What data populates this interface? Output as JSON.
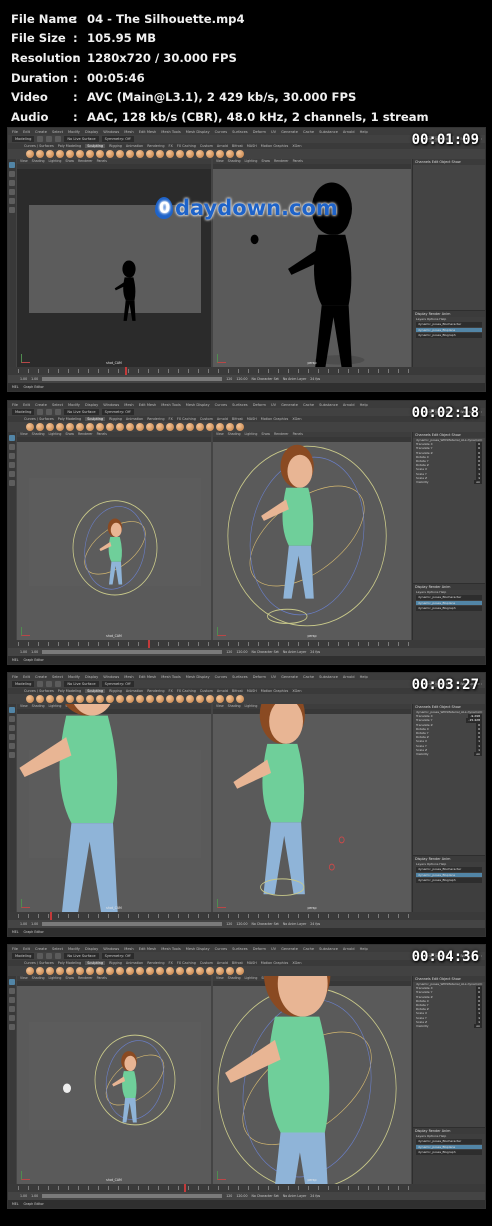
{
  "file_info": [
    {
      "key": "File Name",
      "value": "04 - The Silhouette.mp4"
    },
    {
      "key": "File Size",
      "value": "105.95 MB"
    },
    {
      "key": "Resolution",
      "value": "1280x720 / 30.000 FPS"
    },
    {
      "key": "Duration",
      "value": "00:05:46"
    },
    {
      "key": "Video",
      "value": "AVC (Main@L3.1), 2 429 kb/s, 30.000 FPS"
    },
    {
      "key": "Audio",
      "value": "AAC, 128 kb/s (CBR), 48.0 kHz, 2 channels, 1 stream"
    }
  ],
  "colon": ":",
  "app": {
    "menus": [
      "File",
      "Edit",
      "Create",
      "Select",
      "Modify",
      "Display",
      "Windows",
      "Mesh",
      "Edit Mesh",
      "Mesh Tools",
      "Mesh Display",
      "Curves",
      "Surfaces",
      "Deform",
      "UV",
      "Generate",
      "Cache",
      "Substance",
      "Arnold",
      "Help"
    ],
    "workspace": "Workspace :",
    "mode": "Modeling",
    "no_live_surface": "No Live Surface",
    "symmetry": "Symmetry: Off",
    "sign_in": "Show Optimizer",
    "shelf_tabs": [
      "Curves / Surfaces",
      "Poly Modeling",
      "Sculpting",
      "Rigging",
      "Animation",
      "Rendering",
      "FX",
      "FX Caching",
      "Custom",
      "Arnold",
      "Bifrost",
      "MASH",
      "Motion Graphics",
      "XGen"
    ],
    "active_shelf_tab": "Sculpting",
    "viewport_menus": [
      "View",
      "Shading",
      "Lighting",
      "Show",
      "Renderer",
      "Panels"
    ],
    "left_camera_label": "shot_CAM",
    "right_camera_label": "persp",
    "channels_title": "Channels  Edit  Object  Show",
    "display_tabs": "Display  Render  Anim",
    "layer_menu": "Layers  Options  Help",
    "graph_editor": "Graph Editor",
    "no_character_set": "No Character Set",
    "no_anim_layer": "No Anim Layer",
    "fps": "24 fps",
    "cmd_lang": "MEL"
  },
  "frames": [
    {
      "timestamp": "00:01:09",
      "left_dark": true,
      "channel_object": "",
      "channels": [],
      "layers": [
        "dynamic_poses_BGcharacter",
        "dynamic_poses_BGplane",
        "dynamic_poses_BGgraph"
      ],
      "highlight_layer": 1,
      "playhead": 0.27,
      "range": [
        "1.00",
        "1.00",
        "120",
        "120.00"
      ]
    },
    {
      "timestamp": "00:02:18",
      "left_dark": false,
      "channel_object": "dynamic_poses_WithMaterial_ALL:dynamicC",
      "channels": [
        {
          "name": "Translate X",
          "value": "0"
        },
        {
          "name": "Translate Y",
          "value": "0"
        },
        {
          "name": "Translate Z",
          "value": "0"
        },
        {
          "name": "Rotate X",
          "value": "0"
        },
        {
          "name": "Rotate Y",
          "value": "0"
        },
        {
          "name": "Rotate Z",
          "value": "0"
        },
        {
          "name": "Scale X",
          "value": "1"
        },
        {
          "name": "Scale Y",
          "value": "1"
        },
        {
          "name": "Scale Z",
          "value": "1"
        },
        {
          "name": "Visibility",
          "value": "on"
        }
      ],
      "layers": [
        "dynamic_poses_BGcharacter",
        "dynamic_poses_BGplane",
        "dynamic_poses_BGgraph"
      ],
      "highlight_layer": 1,
      "playhead": 0.33,
      "range": [
        "1.00",
        "1.00",
        "120",
        "120.00"
      ]
    },
    {
      "timestamp": "00:03:27",
      "left_dark": false,
      "channel_object": "dynamic_poses_WithMaterial_ALL:dynamicC",
      "channels": [
        {
          "name": "Translate X",
          "value": "-9.298"
        },
        {
          "name": "Translate Y",
          "value": "-15.428"
        },
        {
          "name": "Translate Z",
          "value": "0"
        },
        {
          "name": "Rotate X",
          "value": "0"
        },
        {
          "name": "Rotate Y",
          "value": "0"
        },
        {
          "name": "Rotate Z",
          "value": "0"
        },
        {
          "name": "Scale X",
          "value": "1"
        },
        {
          "name": "Scale Y",
          "value": "1"
        },
        {
          "name": "Scale Z",
          "value": "1"
        },
        {
          "name": "Visibility",
          "value": "on"
        }
      ],
      "layers": [
        "dynamic_poses_BGcharacter",
        "dynamic_poses_BGplane",
        "dynamic_poses_BGgraph"
      ],
      "highlight_layer": 1,
      "playhead": 0.08,
      "range": [
        "1.00",
        "1.00",
        "120",
        "120.00"
      ]
    },
    {
      "timestamp": "00:04:36",
      "left_dark": false,
      "channel_object": "dynamic_poses_WithMaterial_ALL:dynamicC",
      "channels": [
        {
          "name": "Translate X",
          "value": "0"
        },
        {
          "name": "Translate Y",
          "value": "0"
        },
        {
          "name": "Translate Z",
          "value": "0"
        },
        {
          "name": "Rotate X",
          "value": "0"
        },
        {
          "name": "Rotate Y",
          "value": "0"
        },
        {
          "name": "Rotate Z",
          "value": "0"
        },
        {
          "name": "Scale X",
          "value": "1"
        },
        {
          "name": "Scale Y",
          "value": "1"
        },
        {
          "name": "Scale Z",
          "value": "1"
        },
        {
          "name": "Visibility",
          "value": "on"
        }
      ],
      "layers": [
        "dynamic_poses_BGcharacter",
        "dynamic_poses_BGplane",
        "dynamic_poses_BGgraph"
      ],
      "highlight_layer": 1,
      "playhead": 0.42,
      "range": [
        "1.00",
        "1.00",
        "120",
        "120.00"
      ]
    }
  ],
  "watermark": "daydown.com",
  "colors": {
    "accent": "#5285a6",
    "viewport": "#5a5a5a",
    "watermark": "#1e63c9"
  }
}
